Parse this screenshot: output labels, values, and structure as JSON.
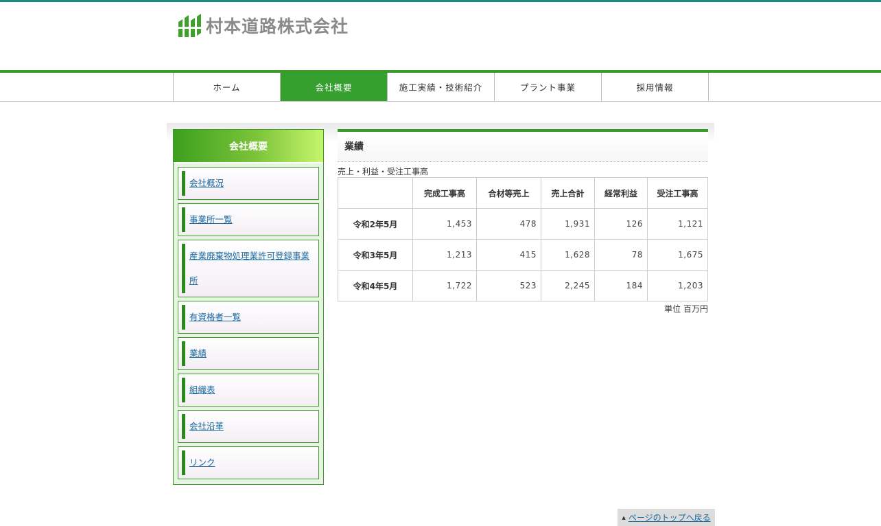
{
  "brand": {
    "name": "村本道路株式会社",
    "logo_icon": "striped-green-logo",
    "accent": "#3a9a2a"
  },
  "nav": [
    {
      "label": "ホーム"
    },
    {
      "label": "会社概要",
      "active": true
    },
    {
      "label": "施工実績・技術紹介"
    },
    {
      "label": "プラント事業"
    },
    {
      "label": "採用情報"
    }
  ],
  "sidebar": {
    "title": "会社概要",
    "items": [
      {
        "label": "会社概況"
      },
      {
        "label": "事業所一覧"
      },
      {
        "label": "産業廃棄物処理業許可登録事業所"
      },
      {
        "label": "有資格者一覧"
      },
      {
        "label": "業績"
      },
      {
        "label": "組織表"
      },
      {
        "label": "会社沿革"
      },
      {
        "label": "リンク"
      }
    ]
  },
  "main": {
    "title": "業績",
    "caption": "売上・利益・受注工事高",
    "columns": [
      "",
      "完成工事高",
      "合材等売上",
      "売上合計",
      "経常利益",
      "受注工事高"
    ],
    "rows": [
      [
        "令和2年5月",
        "1,453",
        "478",
        "1,931",
        "126",
        "1,121"
      ],
      [
        "令和3年5月",
        "1,213",
        "415",
        "1,628",
        "78",
        "1,675"
      ],
      [
        "令和4年5月",
        "1,722",
        "523",
        "2,245",
        "184",
        "1,203"
      ]
    ],
    "unit": "単位 百万円"
  },
  "footer": {
    "to_top": "ページのトップへ戻る",
    "to_top_icon": "up-triangle-icon"
  }
}
